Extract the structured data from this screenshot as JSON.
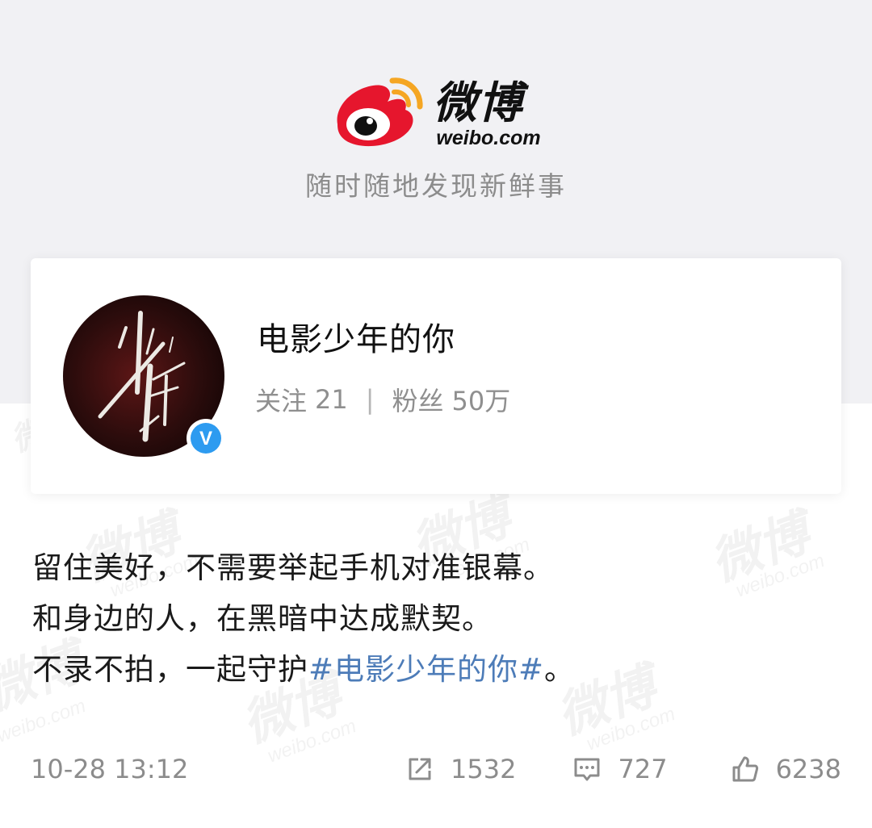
{
  "header": {
    "logo_name": "微博",
    "logo_domain": "weibo.com",
    "slogan": "随时随地发现新鲜事"
  },
  "account": {
    "name": "电影少年的你",
    "following_label": "关注",
    "following_count": "21",
    "separator": "|",
    "followers_label": "粉丝",
    "followers_count": "50万",
    "verified": true,
    "verified_badge_letter": "V"
  },
  "post": {
    "line1": "留住美好，不需要举起手机对准银幕。",
    "line2": "和身边的人，在黑暗中达成默契。",
    "line3_prefix": "不录不拍，一起守护",
    "hashtag": "#电影少年的你#",
    "line3_suffix": "。"
  },
  "footer": {
    "timestamp": "10-28 13:12",
    "repost_count": "1532",
    "comment_count": "727",
    "like_count": "6238"
  },
  "icons": [
    "weibo-logo-icon",
    "verified-badge-icon",
    "repost-icon",
    "comment-icon",
    "like-icon"
  ],
  "colors": {
    "header_background": "#f1f1f4",
    "hashtag": "#4d7cb8",
    "verified_badge": "#2d9bf0",
    "logo_red": "#e6162d",
    "logo_orange": "#f5a623",
    "secondary_text": "#8c8c8c"
  }
}
